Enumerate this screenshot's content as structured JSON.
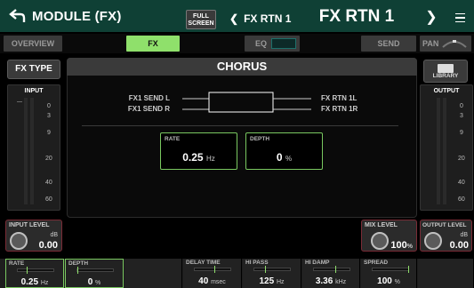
{
  "header": {
    "title": "MODULE (FX)",
    "full_screen_line1": "FULL",
    "full_screen_line2": "SCREEN",
    "prev_channel": "FX RTN 1",
    "prev_chevron": "❮",
    "channel_name": "FX RTN 1",
    "next_chevron": "❯",
    "back_icon": "back-arrow-icon",
    "menu_icon": "hamburger-menu-icon"
  },
  "tabs": {
    "overview": "OVERVIEW",
    "fx": "FX",
    "eq": "EQ",
    "send": "SEND",
    "pan": "PAN",
    "active": "FX"
  },
  "fx": {
    "type_button": "FX TYPE",
    "effect_name": "CHORUS",
    "library_button": "LIBRARY",
    "library_icon": "folder-icon",
    "routing": {
      "in_l": "FX1 SEND L",
      "in_r": "FX1 SEND R",
      "out_l": "FX RTN 1L",
      "out_r": "FX RTN 1R"
    },
    "rate": {
      "label": "RATE",
      "value": "0.25",
      "unit": "Hz"
    },
    "depth": {
      "label": "DEPTH",
      "value": "0",
      "unit": "%"
    }
  },
  "meters": {
    "input_label": "INPUT",
    "output_label": "OUTPUT",
    "scale": [
      "0",
      "3",
      "9",
      "20",
      "40",
      "60"
    ]
  },
  "knobs": {
    "input_level": {
      "label": "INPUT LEVEL",
      "unit": "dB",
      "value": "0.00"
    },
    "mix_level": {
      "label": "MIX LEVEL",
      "value": "100",
      "unit": "%"
    },
    "output_level": {
      "label": "OUTPUT LEVEL",
      "unit": "dB",
      "value": "0.00"
    }
  },
  "bottom_params": [
    {
      "label": "RATE",
      "value": "0.25",
      "unit": "Hz",
      "level": 0.25
    },
    {
      "label": "DEPTH",
      "value": "0",
      "unit": "%",
      "level": 0.0
    },
    {
      "label": "",
      "value": "",
      "unit": ""
    },
    {
      "label": "DELAY TIME",
      "value": "40",
      "unit": "msec",
      "level": 0.55
    },
    {
      "label": "HI PASS",
      "value": "125",
      "unit": "Hz",
      "level": 0.3
    },
    {
      "label": "HI DAMP",
      "value": "3.36",
      "unit": "kHz",
      "level": 0.6
    },
    {
      "label": "SPREAD",
      "value": "100",
      "unit": "%",
      "level": 1.0
    },
    {
      "label": "",
      "value": "",
      "unit": ""
    }
  ],
  "colors": {
    "accent_green": "#8fe06b",
    "header_bg": "#0f4035",
    "knob_border": "#7a2b35"
  }
}
